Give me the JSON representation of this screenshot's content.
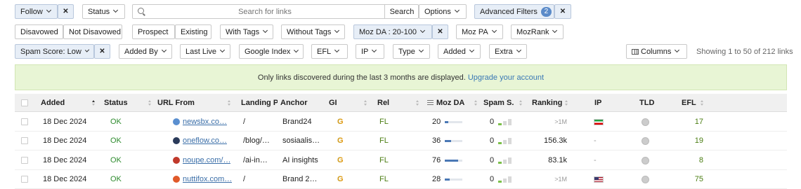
{
  "toolbar_row1": {
    "follow": "Follow",
    "status": "Status",
    "search_placeholder": "Search for links",
    "search_button": "Search",
    "options": "Options",
    "advanced_filters": "Advanced Filters",
    "advanced_filters_count": "2"
  },
  "toolbar_row2": {
    "disavowed": "Disavowed",
    "not_disavowed": "Not Disavowed",
    "prospect": "Prospect",
    "existing": "Existing",
    "with_tags": "With Tags",
    "without_tags": "Without Tags",
    "moz_da_filter": "Moz DA : 20-100",
    "moz_pa": "Moz PA",
    "mozrank": "MozRank"
  },
  "toolbar_row3": {
    "spam_score": "Spam Score: Low",
    "added_by": "Added By",
    "last_live": "Last Live",
    "google_index": "Google Index",
    "efl": "EFL",
    "ip": "IP",
    "type": "Type",
    "added": "Added",
    "extra": "Extra",
    "columns": "Columns",
    "showing": "Showing 1 to 50 of 212 links"
  },
  "banner": {
    "text": "Only links discovered during the last 3 months are displayed.",
    "link": "Upgrade your account"
  },
  "table": {
    "headers": {
      "added": "Added",
      "status": "Status",
      "url_from": "URL From",
      "landing": "Landing P",
      "anchor": "Anchor",
      "gi": "GI",
      "rel": "Rel",
      "moz_da": "Moz DA",
      "spam": "Spam S.",
      "ranking": "Ranking",
      "ip": "IP",
      "tld": "TLD",
      "efl": "EFL"
    },
    "rows": [
      {
        "added": "18 Dec 2024",
        "status": "OK",
        "url_from": "newsbx.co…",
        "favicon_color": "#5a8fd0",
        "landing": "/",
        "anchor": "Brand24",
        "gi": "G",
        "rel": "FL",
        "moz_da": "20",
        "moz_da_value": 20,
        "spam": "0",
        "ranking": ">1M",
        "ip": "-",
        "flag": "ir",
        "efl": "17"
      },
      {
        "added": "18 Dec 2024",
        "status": "OK",
        "url_from": "oneflow.co…",
        "favicon_color": "#2a3a5a",
        "landing": "/blog/…",
        "anchor": "sosiaalis…",
        "gi": "G",
        "rel": "FL",
        "moz_da": "36",
        "moz_da_value": 36,
        "spam": "0",
        "ranking": "156.3k",
        "ip": "-",
        "flag": "",
        "efl": "19"
      },
      {
        "added": "18 Dec 2024",
        "status": "OK",
        "url_from": "noupe.com/…",
        "favicon_color": "#c0392b",
        "landing": "/ai-in…",
        "anchor": "AI insights",
        "gi": "G",
        "rel": "FL",
        "moz_da": "76",
        "moz_da_value": 76,
        "spam": "0",
        "ranking": "83.1k",
        "ip": "-",
        "flag": "",
        "efl": "8"
      },
      {
        "added": "18 Dec 2024",
        "status": "OK",
        "url_from": "nuttifox.com…",
        "favicon_color": "#e05a2a",
        "landing": "/",
        "anchor": "Brand 2…",
        "gi": "G",
        "rel": "FL",
        "moz_da": "28",
        "moz_da_value": 28,
        "spam": "0",
        "ranking": ">1M",
        "ip": "-",
        "flag": "us",
        "efl": "75"
      }
    ]
  }
}
